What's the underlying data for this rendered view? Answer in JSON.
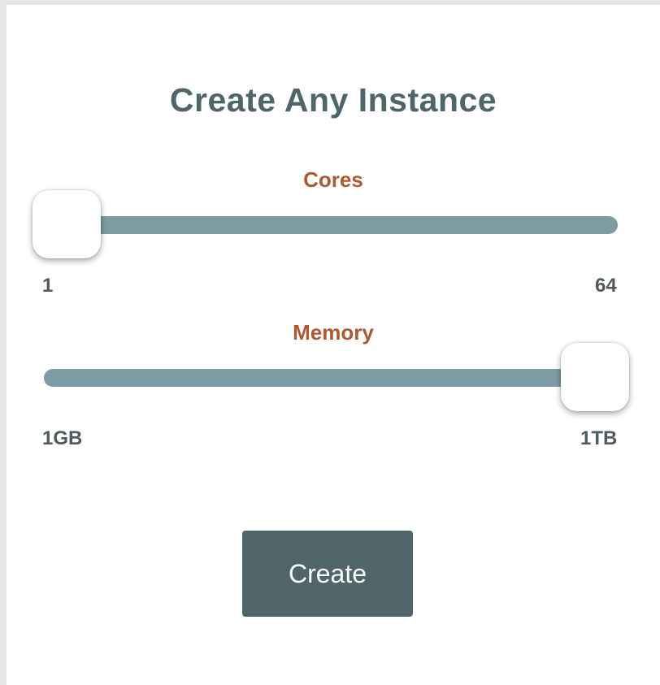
{
  "title": "Create Any Instance",
  "colors": {
    "title": "#4e656a",
    "label": "#ab5a33",
    "track": "#7d9ba3",
    "button": "#4f6569"
  },
  "cores": {
    "label": "Cores",
    "min_label": "1",
    "max_label": "64",
    "value_fraction": 0
  },
  "memory": {
    "label": "Memory",
    "min_label": "1GB",
    "max_label": "1TB",
    "value_fraction": 1
  },
  "create_button": {
    "label": "Create"
  }
}
